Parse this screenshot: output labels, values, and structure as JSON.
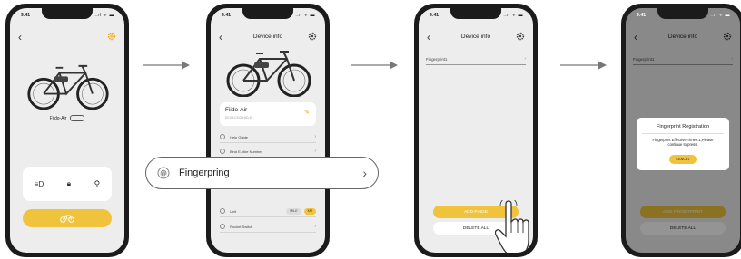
{
  "status": {
    "time": "9:41",
    "indicators": "..ıl ᯤ ▬"
  },
  "screen1": {
    "device_name": "Fiido-Air"
  },
  "screen2": {
    "title": "Device info",
    "device_name": "Fiido-Air",
    "mac": "02:04:C5:0B:A0:15",
    "menu": [
      {
        "label": "Help Guide"
      },
      {
        "label": "Bind E-bike Number"
      }
    ],
    "unit_label": "Unit",
    "unit_options": [
      "MILE",
      "KM"
    ],
    "rocket_label": "Rocket Switch",
    "overlay_label": "Fingerpring"
  },
  "screen3": {
    "title": "Device info",
    "fingerprint_item": "Fingerprint1",
    "add_label": "ADD FINGERPRINT",
    "add_visible": "ADD FINGE",
    "delete_label": "DELETE ALL"
  },
  "screen4": {
    "title": "Device info",
    "fingerprint_item": "Fingerprint1",
    "dialog_title": "Fingerprint Registration",
    "dialog_message": "Fingerprint Effective Times:1,Please continue to press.",
    "cancel_label": "CANCEL",
    "add_label": "ADD FINGERPRINT",
    "delete_label": "DELETE ALL"
  },
  "colors": {
    "accent": "#f0c33c",
    "background": "#ededed",
    "frame": "#1b1b1b"
  }
}
